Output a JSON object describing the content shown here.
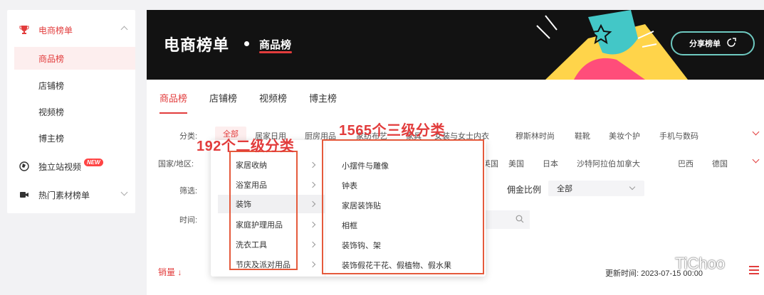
{
  "sidebar": {
    "groups": [
      {
        "label": "电商榜单",
        "icon": "trophy-icon"
      },
      {
        "label": "独立站视频",
        "icon": "globe-icon",
        "badge": "NEW"
      },
      {
        "label": "热门素材榜单",
        "icon": "video-icon"
      }
    ],
    "subitems": [
      "商品榜",
      "店铺榜",
      "视频榜",
      "博主榜"
    ],
    "active_sub": "商品榜"
  },
  "banner": {
    "title": "电商榜单",
    "subtitle": "商品榜",
    "share_label": "分享榜单"
  },
  "tabs": [
    "商品榜",
    "店铺榜",
    "视频榜",
    "博主榜"
  ],
  "filters": {
    "category_label": "分类:",
    "category_chips": [
      "全部",
      "居家日用",
      "厨房用品",
      "家纺布艺",
      "家具",
      "女装与女士内衣",
      "穆斯林时尚",
      "鞋靴",
      "美妆个护",
      "手机与数码"
    ],
    "country_label": "国家/地区:",
    "country_chips": [
      "英国",
      "美国",
      "日本",
      "沙特阿拉伯",
      "加拿大",
      "巴西",
      "德国"
    ],
    "screen_label": "筛选:",
    "commission_label": "佣金比例",
    "commission_value": "全部",
    "time_label": "时间:"
  },
  "dropdown": {
    "level2": [
      "家居收纳",
      "浴室用品",
      "装饰",
      "家庭护理用品",
      "洗衣工具",
      "节庆及派对用品"
    ],
    "level2_selected": "装饰",
    "level3": [
      "小摆件与雕像",
      "钟表",
      "家居装饰贴",
      "相框",
      "装饰钩、架",
      "装饰假花干花、假植物、假水果"
    ]
  },
  "annotations": {
    "left": "192个二级分类",
    "right": "1565个三级分类"
  },
  "footer": {
    "sort_label": "销量",
    "update_time": "更新时间: 2023-07-15 00:00"
  },
  "watermark": "TiChoo",
  "colors": {
    "accent": "#e23c3c",
    "banner_bg": "#121212",
    "annotation": "#e55a3c"
  }
}
